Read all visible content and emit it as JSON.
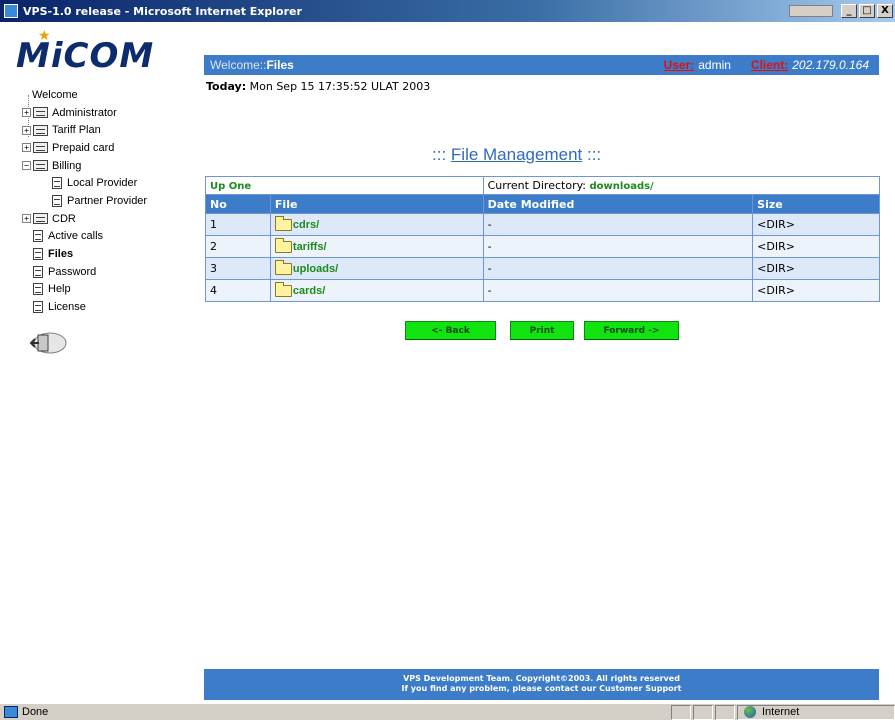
{
  "window": {
    "title": "VPS-1.0 release - Microsoft Internet Explorer",
    "min": "_",
    "max": "□",
    "close": "X"
  },
  "sidebar": {
    "logo": "MiCOM",
    "tree": [
      {
        "label": "Welcome"
      },
      {
        "label": "Administrator"
      },
      {
        "label": "Tariff Plan"
      },
      {
        "label": "Prepaid card"
      },
      {
        "label": "Billing"
      },
      {
        "label": "Local Provider"
      },
      {
        "label": "Partner Provider"
      },
      {
        "label": "CDR"
      },
      {
        "label": "Active calls"
      },
      {
        "label": "Files"
      },
      {
        "label": "Password"
      },
      {
        "label": "Help"
      },
      {
        "label": "License"
      }
    ]
  },
  "header": {
    "welcome": "Welcome::",
    "page": "Files",
    "user_label": "User:",
    "user_value": "admin",
    "client_label": "Client:",
    "client_value": "202.179.0.164"
  },
  "today": {
    "label": "Today:",
    "value": "Mon Sep 15 17:35:52 ULAT 2003"
  },
  "file_management": {
    "prefix": ":::",
    "title": "File Management",
    "suffix": ":::"
  },
  "table": {
    "up_one": "Up One",
    "current_dir_label": "Current Directory:",
    "current_dir": "downloads/",
    "columns": [
      "No",
      "File",
      "Date Modified",
      "Size"
    ],
    "rows": [
      {
        "no": "1",
        "file": "cdrs/",
        "date": "-",
        "size": "<DIR>"
      },
      {
        "no": "2",
        "file": "tariffs/",
        "date": "-",
        "size": "<DIR>"
      },
      {
        "no": "3",
        "file": "uploads/",
        "date": "-",
        "size": "<DIR>"
      },
      {
        "no": "4",
        "file": "cards/",
        "date": "-",
        "size": "<DIR>"
      }
    ]
  },
  "buttons": {
    "back": "<- Back",
    "print": "Print",
    "forward": "Forward ->"
  },
  "footer": {
    "line1": "VPS Development Team. Copyright©2003. All rights reserved",
    "line2": "If you find any problem, please contact our Customer Support"
  },
  "statusbar": {
    "status": "Done",
    "zone": "Internet"
  }
}
